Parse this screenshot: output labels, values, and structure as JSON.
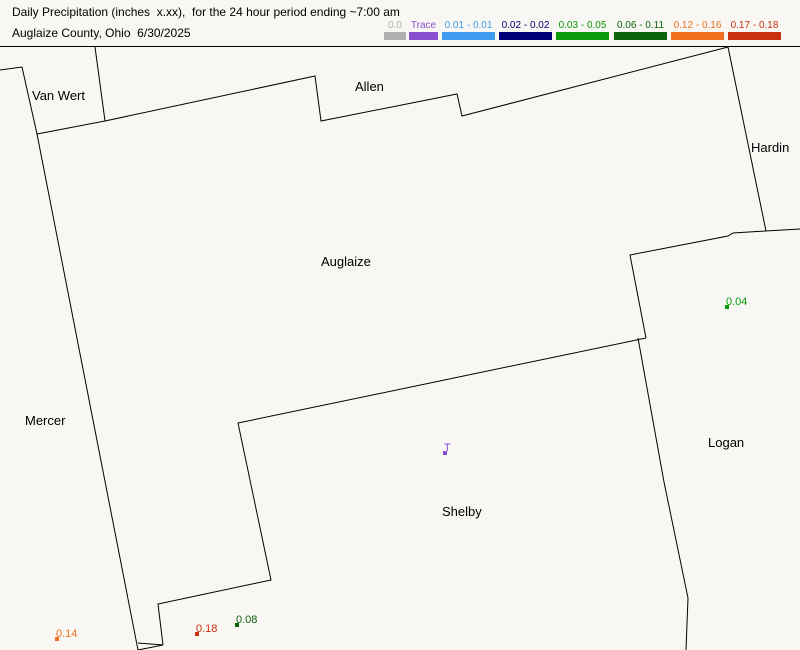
{
  "header": {
    "title": "Daily Precipitation (inches  x.xx),  for the 24 hour period ending ~7:00 am",
    "subtitle": "Auglaize County, Ohio  6/30/2025"
  },
  "legend": [
    {
      "label": "0.0",
      "color": "#b0b0b0"
    },
    {
      "label": "Trace",
      "color": "#8a4fd0"
    },
    {
      "label": "0.01 - 0.01",
      "color": "#3f9cf0"
    },
    {
      "label": "0.02 - 0.02",
      "color": "#00007a"
    },
    {
      "label": "0.03 - 0.05",
      "color": "#0a9a0a"
    },
    {
      "label": "0.06 - 0.11",
      "color": "#0b640b"
    },
    {
      "label": "0.12 - 0.16",
      "color": "#f07020"
    },
    {
      "label": "0.17 - 0.18",
      "color": "#c83010"
    }
  ],
  "counties": [
    "Van Wert",
    "Allen",
    "Hardin",
    "Auglaize",
    "Mercer",
    "Logan",
    "Shelby"
  ],
  "stations": [
    {
      "value": "0.04",
      "color": "#0a9a0a"
    },
    {
      "value": "T",
      "color": "#8a4fd0"
    },
    {
      "value": "0.14",
      "color": "#f07020"
    },
    {
      "value": "0.18",
      "color": "#c83010"
    },
    {
      "value": "0.08",
      "color": "#0b640b"
    }
  ]
}
